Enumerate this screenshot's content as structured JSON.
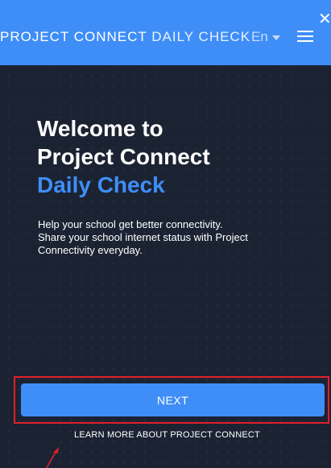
{
  "header": {
    "brand_part1": "PROJECT CONNECT",
    "brand_part2": "DAILY CHECK",
    "language": "En"
  },
  "welcome": {
    "line1": "Welcome to",
    "line2": "Project Connect",
    "line3": "Daily Check"
  },
  "description": {
    "line1": "Help your school get better connectivity.",
    "line2": "Share your school internet status with Project",
    "line3": "Connectivity everyday."
  },
  "actions": {
    "next_label": "NEXT",
    "learn_more_label": "LEARN MORE ABOUT PROJECT CONNECT"
  },
  "icons": {
    "menu": "hamburger-menu-icon",
    "close": "close-icon",
    "language_caret": "chevron-down-icon",
    "annotation": "red-arrow"
  },
  "colors": {
    "accent": "#3f8ef7",
    "background": "#1b2333",
    "highlight": "#e0202a"
  }
}
